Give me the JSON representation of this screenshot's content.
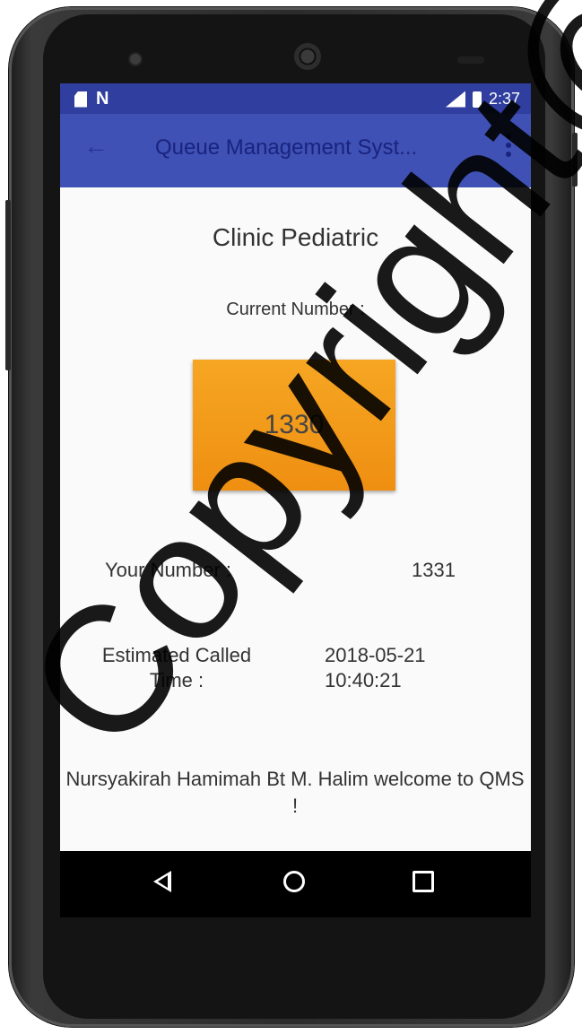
{
  "status_bar": {
    "time": "2:37",
    "left_icons": [
      "sim-icon",
      "n-icon"
    ],
    "right_icons": [
      "signal-icon",
      "battery-icon"
    ],
    "n_glyph": "N"
  },
  "app_bar": {
    "title": "Queue Management Syst...",
    "back_icon": "←"
  },
  "content": {
    "clinic_name": "Clinic Pediatric",
    "current_label": "Current Number :",
    "current_number": "1330",
    "your_number_label": "Your Number :",
    "your_number_value": "1331",
    "estimated_label": "Estimated Called Time :",
    "estimated_date": "2018-05-21",
    "estimated_time": "10:40:21",
    "welcome_message": "Nursyakirah Hamimah Bt M. Halim welcome to QMS !"
  },
  "nav_bar": {
    "icons": [
      "back-triangle-icon",
      "home-circle-icon",
      "recents-square-icon"
    ]
  },
  "watermark": "Copyright@FTo",
  "colors": {
    "status_bar": "#303f9f",
    "app_bar": "#3f51b5",
    "current_box": "#f5a020",
    "screen_bg": "#fafafa"
  }
}
